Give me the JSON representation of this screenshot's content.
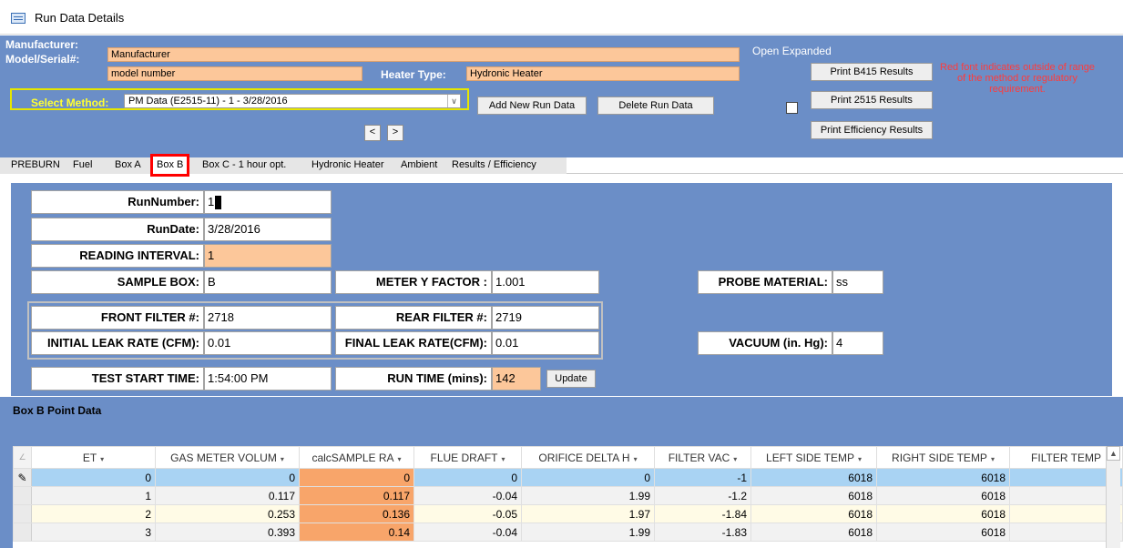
{
  "window": {
    "title": "Run Data Details"
  },
  "header": {
    "manufacturer_label": "Manufacturer:",
    "manufacturer_value": "Manufacturer",
    "model_label": "Model/Serial#:",
    "model_value": "model number",
    "heater_type_label": "Heater Type:",
    "heater_type_value": "Hydronic Heater",
    "select_method_label": "Select Method:",
    "select_method_value": "PM Data (E2515-11) - 1 - 3/28/2016",
    "add_new_run_data": "Add New Run Data",
    "delete_run_data": "Delete Run Data",
    "prev_label": "<",
    "next_label": ">",
    "open_expanded_label": "Open Expanded",
    "open_expanded_checked": false,
    "print_b415": "Print B415 Results",
    "print_2515": "Print 2515 Results",
    "print_efficiency": "Print Efficiency Results",
    "red_note": "Red font indicates outside of range of the method or regulatory requirement.",
    "note_color": "#ff3b3b",
    "accent_color": "#6b8ec7"
  },
  "tabs": [
    {
      "label": "PREBURN"
    },
    {
      "label": "Fuel"
    },
    {
      "label": "Box A"
    },
    {
      "label": "Box B",
      "active": true
    },
    {
      "label": "Box C - 1 hour opt."
    },
    {
      "label": "Hydronic Heater"
    },
    {
      "label": "Ambient"
    },
    {
      "label": "Results / Efficiency"
    }
  ],
  "form": {
    "run_number_label": "RunNumber:",
    "run_number": "1",
    "run_date_label": "RunDate:",
    "run_date": "3/28/2016",
    "reading_interval_label": "READING INTERVAL:",
    "reading_interval": "1",
    "sample_box_label": "SAMPLE BOX:",
    "sample_box": "B",
    "meter_y_label": "METER Y FACTOR :",
    "meter_y": "1.001",
    "probe_material_label": "PROBE MATERIAL:",
    "probe_material": "ss",
    "front_filter_label": "FRONT FILTER #:",
    "front_filter": "2718",
    "rear_filter_label": "REAR FILTER #:",
    "rear_filter": "2719",
    "initial_leak_label": "INITIAL LEAK RATE (CFM):",
    "initial_leak": "0.01",
    "final_leak_label": "FINAL LEAK RATE(CFM):",
    "final_leak": "0.01",
    "vacuum_label": "VACUUM (in. Hg):",
    "vacuum": "4",
    "test_start_label": "TEST START TIME:",
    "test_start": "1:54:00 PM",
    "run_time_label": "RUN TIME (mins):",
    "run_time": "142",
    "update_label": "Update"
  },
  "point_data": {
    "title": "Box B Point Data",
    "columns": [
      "ET",
      "GAS METER VOLUM",
      "calcSAMPLE RA",
      "FLUE DRAFT",
      "ORIFICE DELTA H",
      "FILTER VAC",
      "LEFT SIDE TEMP",
      "RIGHT SIDE TEMP",
      "FILTER TEMP"
    ],
    "rows": [
      [
        "0",
        "0",
        "0",
        "0",
        "0",
        "-1",
        "6018",
        "6018",
        ""
      ],
      [
        "1",
        "0.117",
        "0.117",
        "-0.04",
        "1.99",
        "-1.2",
        "6018",
        "6018",
        ""
      ],
      [
        "2",
        "0.253",
        "0.136",
        "-0.05",
        "1.97",
        "-1.84",
        "6018",
        "6018",
        ""
      ],
      [
        "3",
        "0.393",
        "0.14",
        "-0.04",
        "1.99",
        "-1.83",
        "6018",
        "6018",
        ""
      ]
    ],
    "highlight_color": "#f8a56a",
    "current_row_color": "#a9d3f3"
  }
}
